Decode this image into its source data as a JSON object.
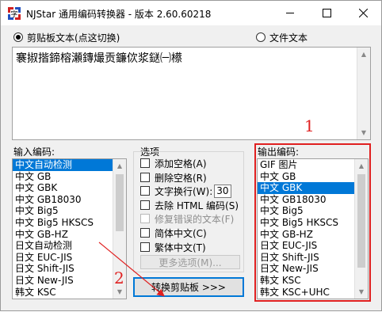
{
  "window": {
    "title": "NJStar 通用编码转换器 - 版本 2.60.60218"
  },
  "mode": {
    "clipboard_label": "剪贴板文本(点这切换)",
    "file_label": "文件文本",
    "selected": "clipboard"
  },
  "text_content": "褰掓揩鍗榕瀬鏄熶贡鐮佽浆鎹㈠櫒",
  "input_encoding": {
    "label": "输入编码:",
    "items": [
      "中文自动检测",
      "中文 GB",
      "中文 GBK",
      "中文 GB18030",
      "中文 Big5",
      "中文 Big5 HKSCS",
      "中文 GB-HZ",
      "日文自动检测",
      "日文 EUC-JIS",
      "日文 Shift-JIS",
      "日文 New-JIS",
      "韩文 KSC"
    ],
    "selected": "中文自动检测"
  },
  "options": {
    "label": "选项",
    "add_spaces": "添加空格(A)",
    "remove_spaces": "删除空格(R)",
    "wrap_text": "文字换行(W):",
    "wrap_width": "30",
    "remove_html": "去除 HTML 编码(S)",
    "fix_errors": "修复错误的文本(F)",
    "simplified": "简体中文(C)",
    "traditional": "繁体中文(T)",
    "more_options": "更多选项(M)..."
  },
  "convert_button": "转换剪贴板 >>>",
  "output_encoding": {
    "label": "输出编码:",
    "items": [
      "GIF 图片",
      "中文 GB",
      "中文 GBK",
      "中文 GB18030",
      "中文 Big5",
      "中文 Big5 HKSCS",
      "中文 GB-HZ",
      "日文 EUC-JIS",
      "日文 Shift-JIS",
      "日文 New-JIS",
      "韩文 KSC",
      "韩文 KSC+UHC"
    ],
    "selected": "中文 GBK"
  },
  "annotations": {
    "marker_1": "1",
    "marker_2": "2",
    "color": "#e02020"
  }
}
